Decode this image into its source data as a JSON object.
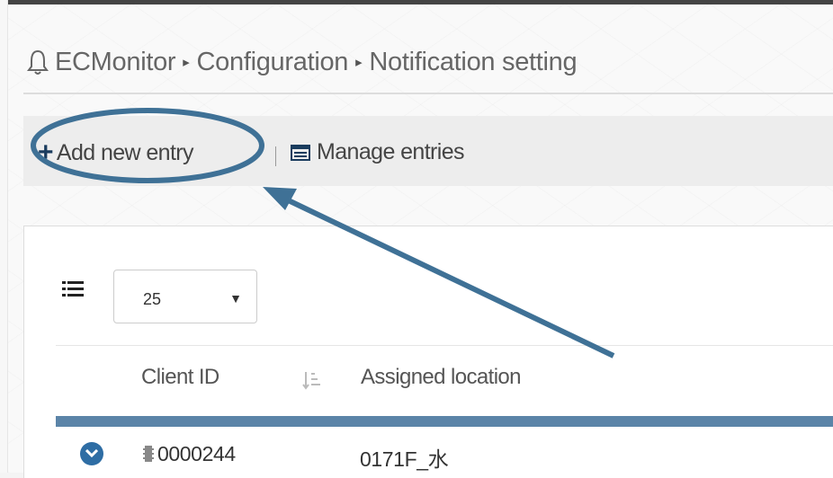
{
  "breadcrumb": {
    "items": [
      "ECMonitor",
      "Configuration",
      "Notification setting"
    ],
    "separator": "▸"
  },
  "toolbar": {
    "add_label": "Add new entry",
    "manage_label": "Manage entries"
  },
  "table": {
    "page_size": "25",
    "columns": [
      "Client ID",
      "Assigned location"
    ],
    "rows": [
      {
        "client_id": "0000244",
        "location": "0171F_水"
      }
    ]
  },
  "colors": {
    "accent": "#2e6da4",
    "header_bar": "#5b84a8",
    "annotation": "#3f7196"
  },
  "icons": [
    "bell-icon",
    "plus-icon",
    "list-window-icon",
    "list-icon",
    "dropdown-arrow-icon",
    "sort-icon",
    "chevron-down-icon",
    "chip-icon"
  ]
}
